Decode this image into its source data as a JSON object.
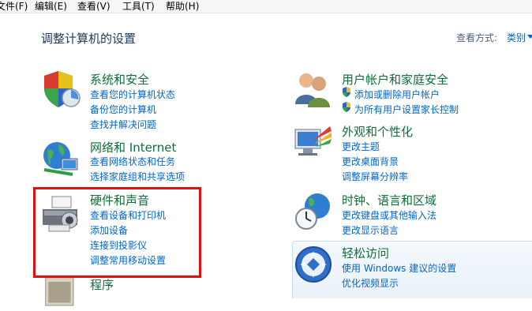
{
  "menu": [
    "文件(F)",
    "编辑(E)",
    "查看(V)",
    "工具(T)",
    "帮助(H)"
  ],
  "page_title": "调整计算机的设置",
  "view_by": {
    "label": "查看方式:",
    "value": "类别"
  },
  "categories": {
    "system": {
      "title": "系统和安全",
      "links": [
        "查看您的计算机状态",
        "备份您的计算机",
        "查找并解决问题"
      ]
    },
    "network": {
      "title": "网络和 Internet",
      "links": [
        "查看网络状态和任务",
        "选择家庭组和共享选项"
      ]
    },
    "hardware": {
      "title": "硬件和声音",
      "links": [
        "查看设备和打印机",
        "添加设备",
        "连接到投影仪",
        "调整常用移动设置"
      ]
    },
    "programs": {
      "title": "程序"
    },
    "users": {
      "title": "用户帐户和家庭安全",
      "links": [
        "添加或删除用户帐户",
        "为所有用户设置家长控制"
      ]
    },
    "appearance": {
      "title": "外观和个性化",
      "links": [
        "更改主题",
        "更改桌面背景",
        "调整屏幕分辨率"
      ]
    },
    "clock": {
      "title": "时钟、语言和区域",
      "links": [
        "更改键盘或其他输入法",
        "更改显示语言"
      ]
    },
    "ease": {
      "title": "轻松访问",
      "links": [
        "使用 Windows 建议的设置",
        "优化视频显示"
      ]
    }
  },
  "colors": {
    "accent_link": "#0066cc",
    "category_title": "#0e6e3a",
    "highlight": "#e01010"
  }
}
